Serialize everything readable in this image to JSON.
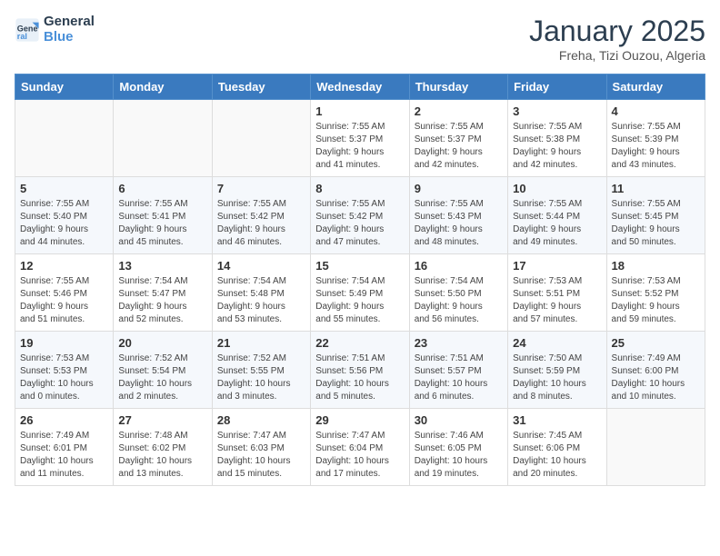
{
  "header": {
    "logo_line1": "General",
    "logo_line2": "Blue",
    "month_title": "January 2025",
    "location": "Freha, Tizi Ouzou, Algeria"
  },
  "weekdays": [
    "Sunday",
    "Monday",
    "Tuesday",
    "Wednesday",
    "Thursday",
    "Friday",
    "Saturday"
  ],
  "weeks": [
    [
      {
        "day": "",
        "info": ""
      },
      {
        "day": "",
        "info": ""
      },
      {
        "day": "",
        "info": ""
      },
      {
        "day": "1",
        "info": "Sunrise: 7:55 AM\nSunset: 5:37 PM\nDaylight: 9 hours\nand 41 minutes."
      },
      {
        "day": "2",
        "info": "Sunrise: 7:55 AM\nSunset: 5:37 PM\nDaylight: 9 hours\nand 42 minutes."
      },
      {
        "day": "3",
        "info": "Sunrise: 7:55 AM\nSunset: 5:38 PM\nDaylight: 9 hours\nand 42 minutes."
      },
      {
        "day": "4",
        "info": "Sunrise: 7:55 AM\nSunset: 5:39 PM\nDaylight: 9 hours\nand 43 minutes."
      }
    ],
    [
      {
        "day": "5",
        "info": "Sunrise: 7:55 AM\nSunset: 5:40 PM\nDaylight: 9 hours\nand 44 minutes."
      },
      {
        "day": "6",
        "info": "Sunrise: 7:55 AM\nSunset: 5:41 PM\nDaylight: 9 hours\nand 45 minutes."
      },
      {
        "day": "7",
        "info": "Sunrise: 7:55 AM\nSunset: 5:42 PM\nDaylight: 9 hours\nand 46 minutes."
      },
      {
        "day": "8",
        "info": "Sunrise: 7:55 AM\nSunset: 5:42 PM\nDaylight: 9 hours\nand 47 minutes."
      },
      {
        "day": "9",
        "info": "Sunrise: 7:55 AM\nSunset: 5:43 PM\nDaylight: 9 hours\nand 48 minutes."
      },
      {
        "day": "10",
        "info": "Sunrise: 7:55 AM\nSunset: 5:44 PM\nDaylight: 9 hours\nand 49 minutes."
      },
      {
        "day": "11",
        "info": "Sunrise: 7:55 AM\nSunset: 5:45 PM\nDaylight: 9 hours\nand 50 minutes."
      }
    ],
    [
      {
        "day": "12",
        "info": "Sunrise: 7:55 AM\nSunset: 5:46 PM\nDaylight: 9 hours\nand 51 minutes."
      },
      {
        "day": "13",
        "info": "Sunrise: 7:54 AM\nSunset: 5:47 PM\nDaylight: 9 hours\nand 52 minutes."
      },
      {
        "day": "14",
        "info": "Sunrise: 7:54 AM\nSunset: 5:48 PM\nDaylight: 9 hours\nand 53 minutes."
      },
      {
        "day": "15",
        "info": "Sunrise: 7:54 AM\nSunset: 5:49 PM\nDaylight: 9 hours\nand 55 minutes."
      },
      {
        "day": "16",
        "info": "Sunrise: 7:54 AM\nSunset: 5:50 PM\nDaylight: 9 hours\nand 56 minutes."
      },
      {
        "day": "17",
        "info": "Sunrise: 7:53 AM\nSunset: 5:51 PM\nDaylight: 9 hours\nand 57 minutes."
      },
      {
        "day": "18",
        "info": "Sunrise: 7:53 AM\nSunset: 5:52 PM\nDaylight: 9 hours\nand 59 minutes."
      }
    ],
    [
      {
        "day": "19",
        "info": "Sunrise: 7:53 AM\nSunset: 5:53 PM\nDaylight: 10 hours\nand 0 minutes."
      },
      {
        "day": "20",
        "info": "Sunrise: 7:52 AM\nSunset: 5:54 PM\nDaylight: 10 hours\nand 2 minutes."
      },
      {
        "day": "21",
        "info": "Sunrise: 7:52 AM\nSunset: 5:55 PM\nDaylight: 10 hours\nand 3 minutes."
      },
      {
        "day": "22",
        "info": "Sunrise: 7:51 AM\nSunset: 5:56 PM\nDaylight: 10 hours\nand 5 minutes."
      },
      {
        "day": "23",
        "info": "Sunrise: 7:51 AM\nSunset: 5:57 PM\nDaylight: 10 hours\nand 6 minutes."
      },
      {
        "day": "24",
        "info": "Sunrise: 7:50 AM\nSunset: 5:59 PM\nDaylight: 10 hours\nand 8 minutes."
      },
      {
        "day": "25",
        "info": "Sunrise: 7:49 AM\nSunset: 6:00 PM\nDaylight: 10 hours\nand 10 minutes."
      }
    ],
    [
      {
        "day": "26",
        "info": "Sunrise: 7:49 AM\nSunset: 6:01 PM\nDaylight: 10 hours\nand 11 minutes."
      },
      {
        "day": "27",
        "info": "Sunrise: 7:48 AM\nSunset: 6:02 PM\nDaylight: 10 hours\nand 13 minutes."
      },
      {
        "day": "28",
        "info": "Sunrise: 7:47 AM\nSunset: 6:03 PM\nDaylight: 10 hours\nand 15 minutes."
      },
      {
        "day": "29",
        "info": "Sunrise: 7:47 AM\nSunset: 6:04 PM\nDaylight: 10 hours\nand 17 minutes."
      },
      {
        "day": "30",
        "info": "Sunrise: 7:46 AM\nSunset: 6:05 PM\nDaylight: 10 hours\nand 19 minutes."
      },
      {
        "day": "31",
        "info": "Sunrise: 7:45 AM\nSunset: 6:06 PM\nDaylight: 10 hours\nand 20 minutes."
      },
      {
        "day": "",
        "info": ""
      }
    ]
  ]
}
